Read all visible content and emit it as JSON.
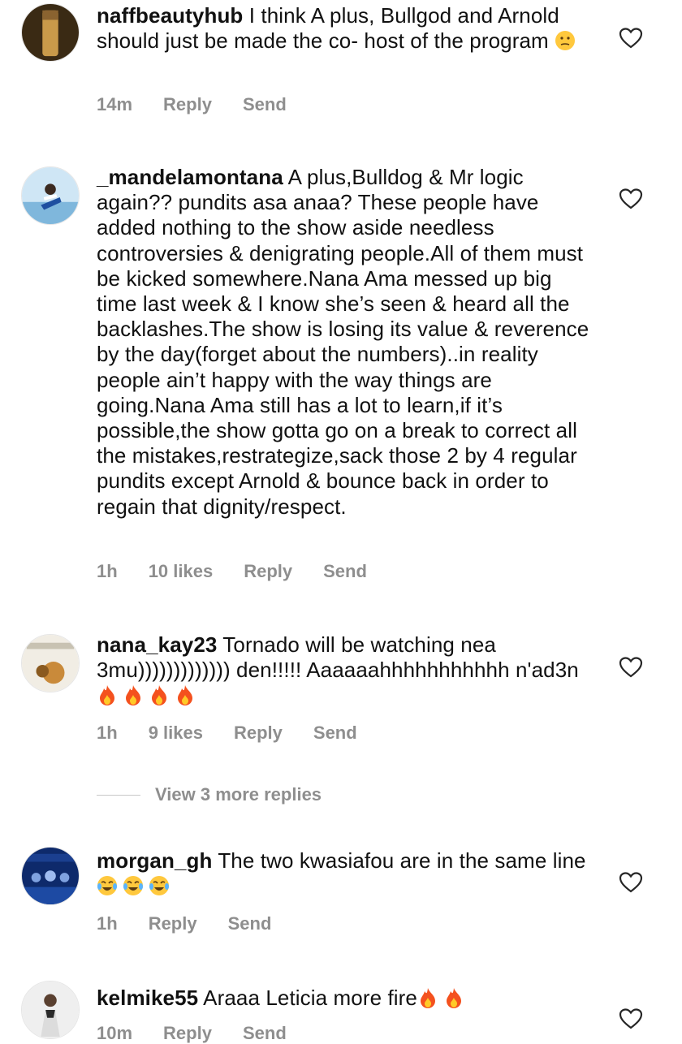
{
  "comments": [
    {
      "username": "naffbeautyhub",
      "text": " I think A plus, Bullgod and Arnold should just be made the co- host of the program ",
      "emojis": [
        "thinking-face"
      ],
      "time": "14m",
      "likes": "",
      "reply": "Reply",
      "send": "Send"
    },
    {
      "username": "_mandelamontana",
      "text": " A plus,Bulldog & Mr logic again?? pundits asa anaa? These people have added nothing to the show aside needless controversies & denigrating people.All of them must be kicked somewhere.Nana Ama messed up big time last week & I know she’s seen & heard all the backlashes.The show is losing its value & reverence by the day(forget about the numbers)..in reality people ain’t happy with the way things are going.Nana Ama still has a lot to learn,if it’s possible,the show gotta go on a break to correct all the mistakes,restrategize,sack those 2 by 4 regular pundits except Arnold & bounce back in order to regain that dignity/respect.",
      "emojis": [],
      "time": "1h",
      "likes": "10 likes",
      "reply": "Reply",
      "send": "Send"
    },
    {
      "username": "nana_kay23",
      "text": " Tornado will be watching nea 3mu))))))))))))) den!!!!! Aaaaaahhhhhhhhhhh n'ad3n ",
      "emojis": [
        "fire",
        "fire",
        "fire",
        "fire"
      ],
      "time": "1h",
      "likes": "9 likes",
      "reply": "Reply",
      "send": "Send"
    },
    {
      "username": "morgan_gh",
      "text": " The two kwasiafou are in the same line ",
      "emojis": [
        "tears-of-joy",
        "tears-of-joy",
        "tears-of-joy"
      ],
      "time": "1h",
      "likes": "",
      "reply": "Reply",
      "send": "Send"
    },
    {
      "username": "kelmike55",
      "text": " Araaa Leticia more fire",
      "emojis": [
        "fire",
        "fire"
      ],
      "time": "10m",
      "likes": "",
      "reply": "Reply",
      "send": "Send"
    }
  ],
  "view_more": "View 3 more replies",
  "colors": {
    "text": "#111111",
    "meta": "#8e8e8e",
    "divider": "#c7c7c7"
  },
  "icons": {
    "like": "heart-outline-icon"
  }
}
